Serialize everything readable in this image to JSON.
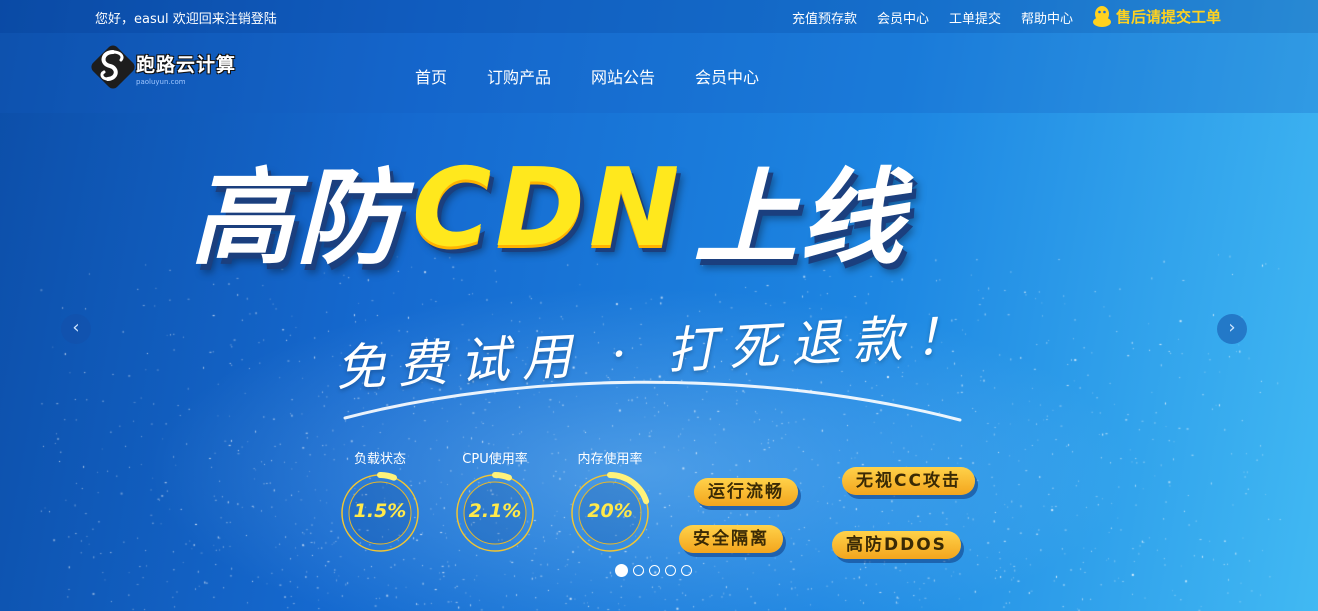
{
  "topbar": {
    "greeting": "您好，easul 欢迎回来",
    "logout": "注销",
    "login": "登陆",
    "links": [
      "充值预存款",
      "会员中心",
      "工单提交",
      "帮助中心"
    ],
    "support": "售后请提交工单",
    "support_icon": "qq-penguin-icon"
  },
  "logo": {
    "title": "跑路云计算",
    "subtitle": "paoluyun.com"
  },
  "nav": [
    "首页",
    "订购产品",
    "网站公告",
    "会员中心"
  ],
  "banner": {
    "headline_left": "高防",
    "headline_mid": "CDN",
    "headline_right": "上线",
    "subline": "免费试用 · 打死退款！",
    "gauges": [
      {
        "label": "负载状态",
        "value": "1.5%",
        "fraction": 0.015
      },
      {
        "label": "CPU使用率",
        "value": "2.1%",
        "fraction": 0.021
      },
      {
        "label": "内存使用率",
        "value": "20%",
        "fraction": 0.2
      }
    ],
    "badges": [
      "运行流畅",
      "无视CC攻击",
      "安全隔离",
      "高防DDOS"
    ],
    "prev": "‹",
    "next": "›",
    "slides": 5,
    "active_slide": 1
  },
  "colors": {
    "accent_yellow": "#ffe81d",
    "support_yellow": "#ffd21f",
    "badge_orange": "#f3a51d"
  }
}
